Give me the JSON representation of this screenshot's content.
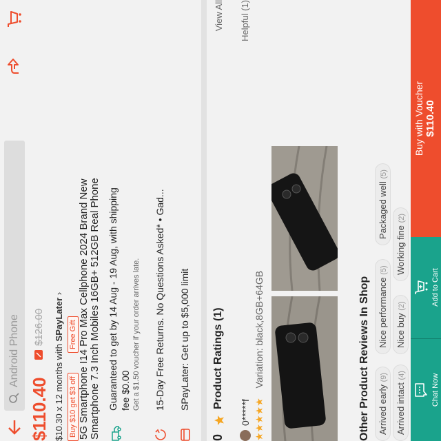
{
  "search": {
    "placeholder": "Android Phone"
  },
  "price": {
    "current": "$110.40",
    "original": "$126.00",
    "installment_prefix": "$10.30 x 12 months with ",
    "installment_brand": "SPayLater",
    "installment_arrow": "›",
    "promo_tags": [
      "Buy $10 get $3 off",
      "Free Gift"
    ]
  },
  "product": {
    "title_line1": "5G Smartphone I14 Pro Max Cellphone 2024 Brand New",
    "title_line2": "Smartphone 7.3 Inch Mobiles 16GB+ 512GB Real Phone"
  },
  "shipping": {
    "line1": "Guaranteed to get by 14 Aug - 19 Aug, with shipping",
    "line2": "fee $0.00",
    "line3": "Get a $1.50 voucher if your order arrives late."
  },
  "returns": {
    "text": "15-Day Free Returns. No Questions Asked* • Gad..."
  },
  "spaylater": {
    "text": "SPayLater: Get up to $5,000 limit"
  },
  "ratings": {
    "score": "0",
    "label": "Product Ratings (1)",
    "view_all": "View All"
  },
  "review": {
    "user": "0*****f",
    "helpful": "Helpful (1)",
    "variation": "Variation: black,8GB+64GB"
  },
  "shop_reviews": {
    "heading": "Other Product Reviews In Shop",
    "chips": [
      {
        "label": "Arrived early",
        "count": "(9)"
      },
      {
        "label": "Nice performance",
        "count": "(5)"
      },
      {
        "label": "Packaged well",
        "count": "(5)"
      },
      {
        "label": "Arrived intact",
        "count": "(4)"
      },
      {
        "label": "Nice buy",
        "count": "(2)"
      },
      {
        "label": "Working fine",
        "count": "(2)"
      }
    ]
  },
  "bottom_bar": {
    "chat_label": "Chat Now",
    "cart_label": "Add to Cart",
    "buy_line1": "Buy with Voucher",
    "buy_line2": "$110.40"
  },
  "colors": {
    "accent": "#ee4d2d",
    "teal": "#1aa38c"
  }
}
